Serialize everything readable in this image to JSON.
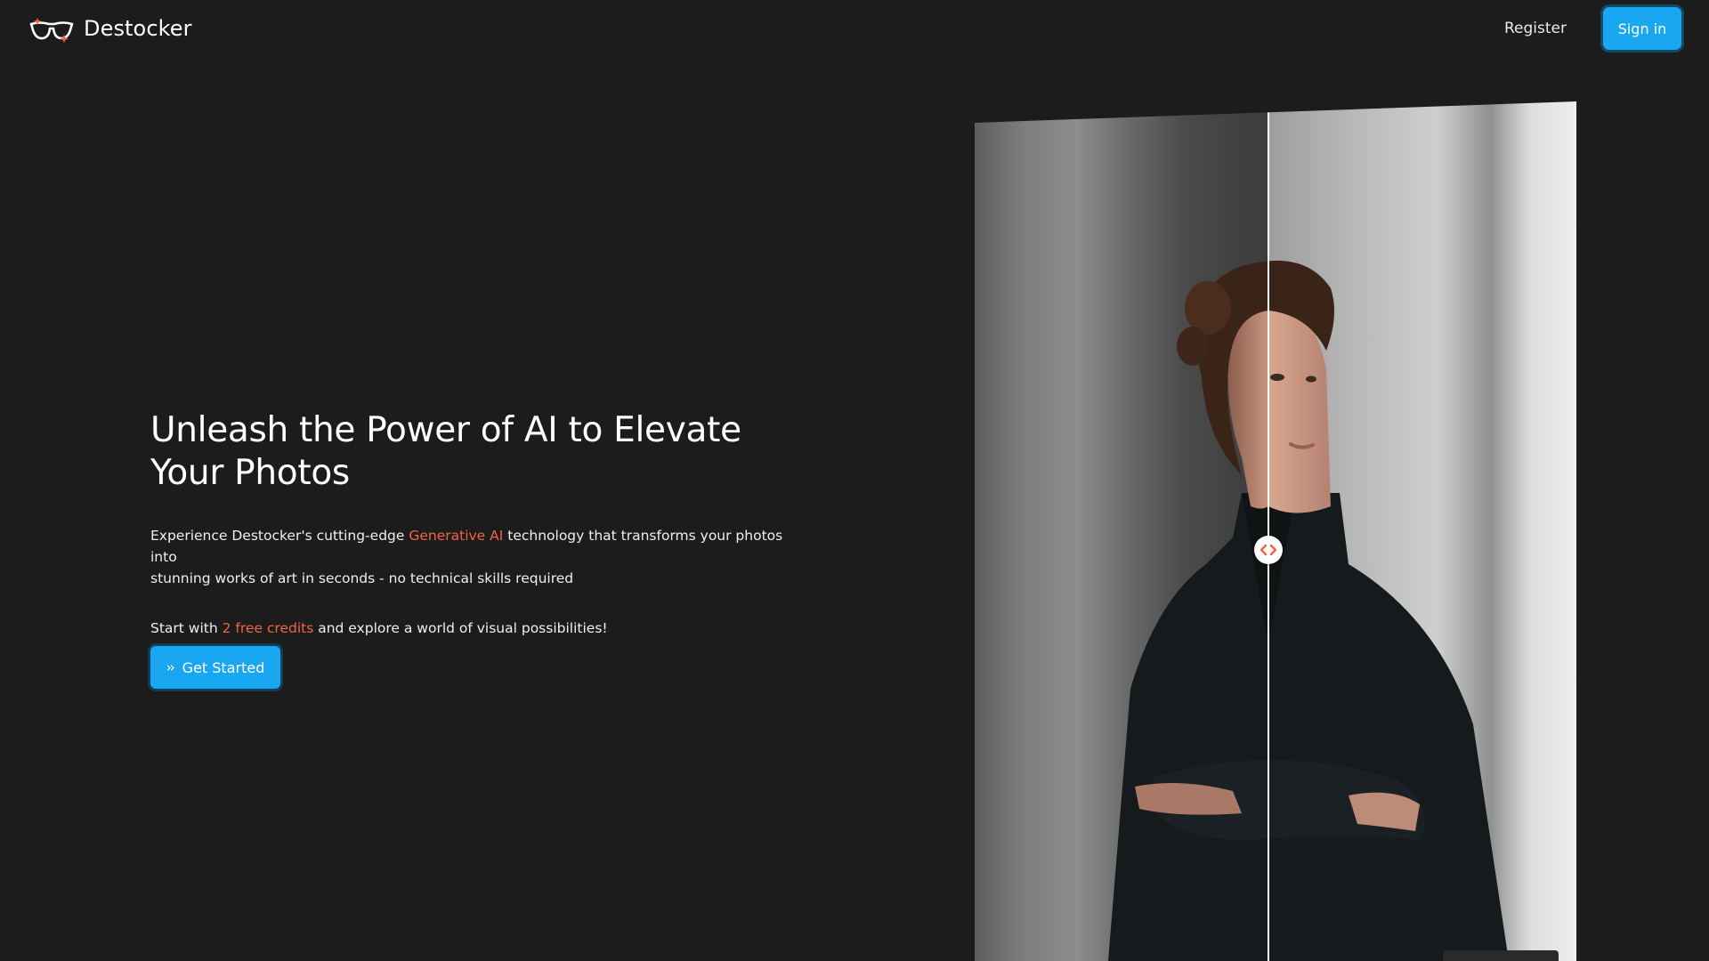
{
  "brand": {
    "name": "Destocker",
    "accent_color": "#f26443",
    "primary_color": "#19a7f1"
  },
  "nav": {
    "register_label": "Register",
    "signin_label": "Sign in"
  },
  "hero": {
    "headline_line1": "Unleash the Power of AI to Elevate",
    "headline_line2": "Your Photos",
    "para_prefix": "Experience Destocker's cutting-edge ",
    "para_highlight": "Generative AI",
    "para_suffix_line1": " technology that transforms your photos into",
    "para_suffix_line2": "stunning works of art in seconds - no technical skills required",
    "credits_prefix": "Start with ",
    "credits_highlight": "2 free credits",
    "credits_suffix": " and explore a world of visual possibilities!",
    "cta_label": "Get Started",
    "cta_icon": "double-chevron-right-icon"
  },
  "comparison": {
    "left_alt": "original-photo",
    "right_alt": "ai-enhanced-photo",
    "handle_icon": "left-right-arrows-icon"
  }
}
